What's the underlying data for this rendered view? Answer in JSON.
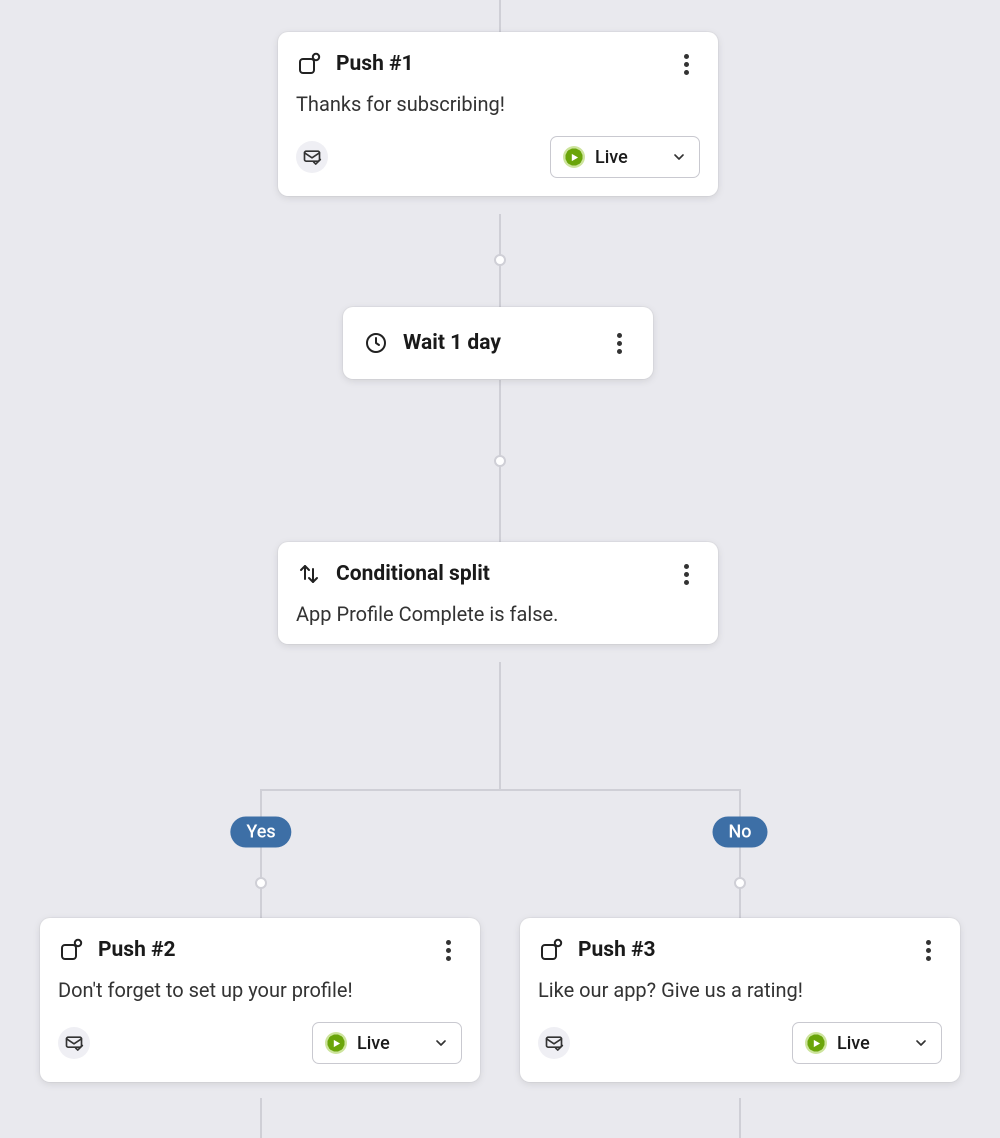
{
  "push1": {
    "title": "Push #1",
    "subtitle": "Thanks for subscribing!",
    "status": "Live"
  },
  "wait": {
    "title": "Wait 1 day"
  },
  "conditional": {
    "title": "Conditional split",
    "subtitle": "App Profile Complete is false."
  },
  "branches": {
    "yes": "Yes",
    "no": "No"
  },
  "push2": {
    "title": "Push #2",
    "subtitle": "Don't forget to set up your profile!",
    "status": "Live"
  },
  "push3": {
    "title": "Push #3",
    "subtitle": "Like our app? Give us a rating!",
    "status": "Live"
  }
}
